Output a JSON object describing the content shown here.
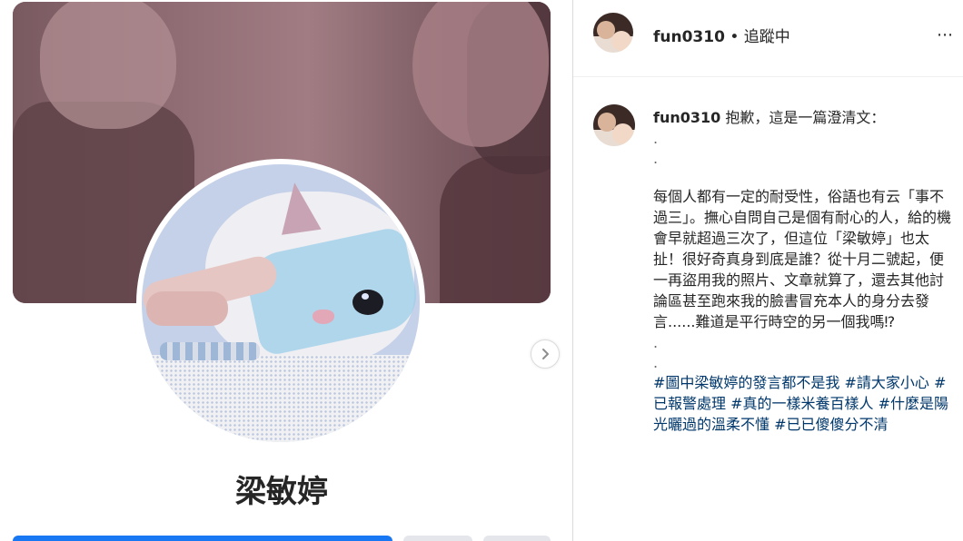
{
  "profile": {
    "name": "梁敏婷"
  },
  "post": {
    "username": "fun0310",
    "separator": "•",
    "follow_status": "追蹤中",
    "more_icon": "⋯",
    "caption_intro": "抱歉，這是一篇澄清文：",
    "dot1": ".",
    "dot2": ".",
    "body": "每個人都有一定的耐受性，俗語也有云「事不過三」。撫心自問自己是個有耐心的人，給的機會早就超過三次了，但這位「梁敏婷」也太扯！很好奇真身到底是誰？從十月二號起，便一再盜用我的照片、文章就算了，還去其他討論區甚至跑來我的臉書冒充本人的身分去發言......難道是平行時空的另一個我嗎⁉",
    "dot3": ".",
    "dot4": ".",
    "hashtags": "#圖中梁敏婷的發言都不是我 #請大家小心 #已報警處理 #真的一樣米養百樣人 #什麼是陽光曬過的溫柔不懂 #已已傻傻分不清"
  },
  "colors": {
    "link": "#00376b",
    "primary_button": "#1877f2",
    "cover_tint": "#8c6b72"
  }
}
